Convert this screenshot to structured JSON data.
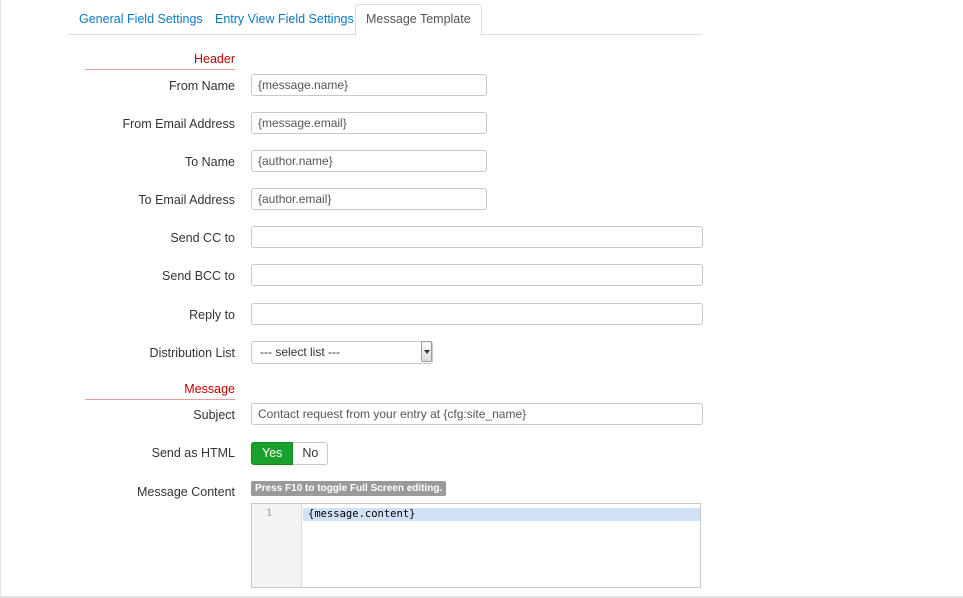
{
  "tabs": [
    {
      "label": "General Field Settings"
    },
    {
      "label": "Entry View Field Settings"
    },
    {
      "label": "Message Template"
    }
  ],
  "header_section": {
    "title": "Header"
  },
  "from_name": {
    "label": "From Name",
    "value": "{message.name}"
  },
  "from_email": {
    "label": "From Email Address",
    "value": "{message.email}"
  },
  "to_name": {
    "label": "To Name",
    "value": "{author.name}"
  },
  "to_email": {
    "label": "To Email Address",
    "value": "{author.email}"
  },
  "send_cc": {
    "label": "Send CC to",
    "value": ""
  },
  "send_bcc": {
    "label": "Send BCC to",
    "value": ""
  },
  "reply_to": {
    "label": "Reply to",
    "value": ""
  },
  "distribution_list": {
    "label": "Distribution List",
    "selected": "--- select list ---"
  },
  "message_section": {
    "title": "Message"
  },
  "subject": {
    "label": "Subject",
    "value": "Contact request from your entry at {cfg:site_name}"
  },
  "send_as_html": {
    "label": "Send as HTML",
    "yes_label": "Yes",
    "no_label": "No",
    "selected": "Yes",
    "active_color": "#1aa12b"
  },
  "message_content": {
    "label": "Message Content",
    "hint": "Press F10 to toggle Full Screen editing.",
    "line_number": "1",
    "code": "{message.content}"
  }
}
